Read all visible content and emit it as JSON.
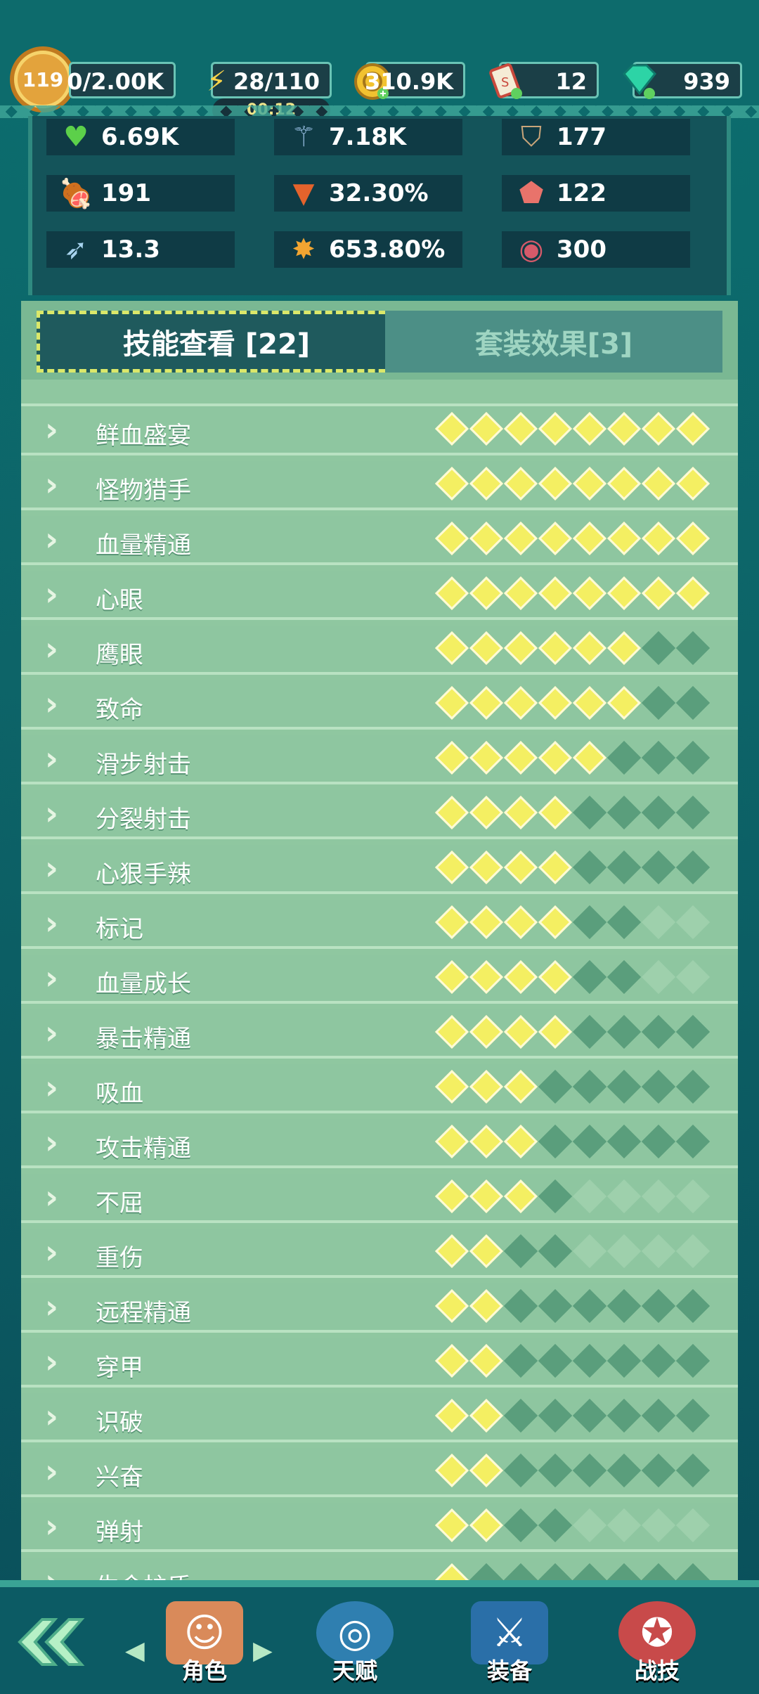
{
  "header": {
    "level": "119",
    "exp": "0/2.00K",
    "energy": "28/110",
    "energy_timer": "00:12",
    "coins": "310.9K",
    "tickets": "12",
    "gems": "939"
  },
  "stats": [
    {
      "icon": "heart-icon",
      "value": "6.69K"
    },
    {
      "icon": "wand-icon",
      "value": "7.18K"
    },
    {
      "icon": "shield-icon",
      "value": "177"
    },
    {
      "icon": "meat-icon",
      "value": "191"
    },
    {
      "icon": "fox-icon",
      "value": "32.30%"
    },
    {
      "icon": "badge-icon",
      "value": "122"
    },
    {
      "icon": "bow-icon",
      "value": "13.3"
    },
    {
      "icon": "burst-icon",
      "value": "653.80%"
    },
    {
      "icon": "ham-icon",
      "value": "300"
    }
  ],
  "tabs": {
    "skills": "技能查看 [22]",
    "sets": "套装效果[3]"
  },
  "skills": [
    {
      "name": "鲜血盛宴",
      "pips": "11111111"
    },
    {
      "name": "怪物猎手",
      "pips": "11111111"
    },
    {
      "name": "血量精通",
      "pips": "11111111"
    },
    {
      "name": "心眼",
      "pips": "11111111"
    },
    {
      "name": "鹰眼",
      "pips": "11111100"
    },
    {
      "name": "致命",
      "pips": "11111100"
    },
    {
      "name": "滑步射击",
      "pips": "11111000"
    },
    {
      "name": "分裂射击",
      "pips": "11110000"
    },
    {
      "name": "心狠手辣",
      "pips": "11110000"
    },
    {
      "name": "标记",
      "pips": "111100xx"
    },
    {
      "name": "血量成长",
      "pips": "111100xx"
    },
    {
      "name": "暴击精通",
      "pips": "11110000"
    },
    {
      "name": "吸血",
      "pips": "11100000"
    },
    {
      "name": "攻击精通",
      "pips": "11100000"
    },
    {
      "name": "不屈",
      "pips": "1110xxxx"
    },
    {
      "name": "重伤",
      "pips": "1100xxxx"
    },
    {
      "name": "远程精通",
      "pips": "11000000"
    },
    {
      "name": "穿甲",
      "pips": "11000000"
    },
    {
      "name": "识破",
      "pips": "11000000"
    },
    {
      "name": "兴奋",
      "pips": "11000000"
    },
    {
      "name": "弹射",
      "pips": "1100xxxx"
    },
    {
      "name": "生命护盾",
      "pips": "10000000"
    }
  ],
  "nav": {
    "character": "角色",
    "talent": "天赋",
    "equipment": "装备",
    "battle_skill": "战技"
  },
  "colors": {
    "pip_on": "#f4ef62",
    "pip_off": "#5a9e7c",
    "panel": "#8fc7a0",
    "bg": "#0c6d6e"
  }
}
